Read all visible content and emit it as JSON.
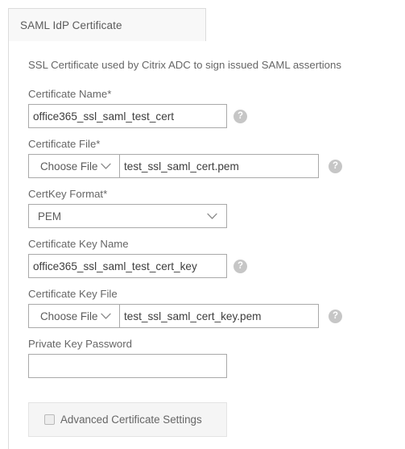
{
  "tab": {
    "label": "SAML IdP Certificate",
    "active": true
  },
  "form": {
    "description": "SSL Certificate used by Citrix ADC to sign issued SAML assertions",
    "fields": {
      "certificate_name": {
        "label": "Certificate Name*",
        "value": "office365_ssl_saml_test_cert",
        "placeholder": "",
        "help_glyph": "?"
      },
      "certificate_file": {
        "label": "Certificate File*",
        "choose_label": "Choose File",
        "value": "test_ssl_saml_cert.pem",
        "placeholder": "",
        "help_glyph": "?"
      },
      "certkey_format": {
        "label": "CertKey Format*",
        "value": "PEM"
      },
      "certificate_key_name": {
        "label": "Certificate Key Name",
        "value": "office365_ssl_saml_test_cert_key",
        "placeholder": "",
        "help_glyph": "?"
      },
      "certificate_key_file": {
        "label": "Certificate Key File",
        "choose_label": "Choose File",
        "value": "test_ssl_saml_cert_key.pem",
        "placeholder": "",
        "help_glyph": "?"
      },
      "private_key_password": {
        "label": "Private Key Password",
        "value": "",
        "placeholder": ""
      },
      "advanced_certificate_settings": {
        "label": "Advanced Certificate Settings",
        "checked": false
      }
    }
  },
  "colors": {
    "label_text": "#666666",
    "input_text": "#3d3d3d",
    "input_border": "#a9a9a9",
    "panel_border": "#dcdcdc",
    "tab_background": "#f8f8f8",
    "help_bubble": "#c6c6c6",
    "advanced_background": "#f5f5f5"
  }
}
